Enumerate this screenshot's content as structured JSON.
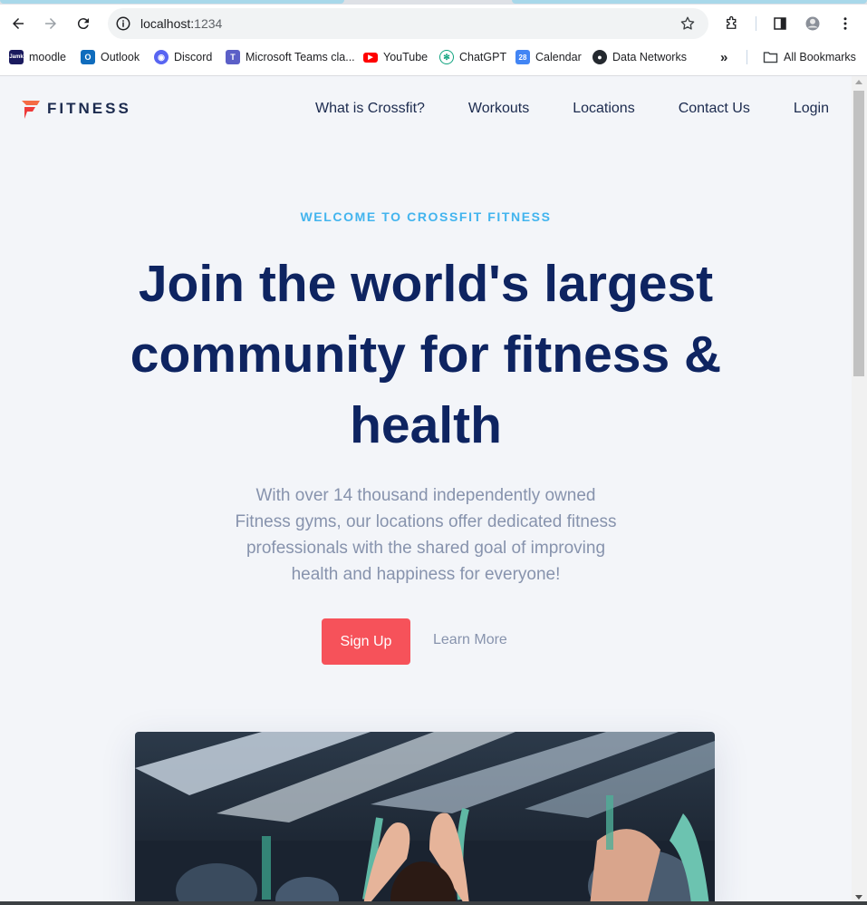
{
  "browser": {
    "url_host": "localhost:",
    "url_port": "1234",
    "bookmarks": [
      {
        "label": "moodle",
        "icon": "jamk-icon",
        "color": "#1a1a5e"
      },
      {
        "label": "Outlook",
        "icon": "outlook-icon",
        "color": "#0f6cbd"
      },
      {
        "label": "Discord",
        "icon": "discord-icon",
        "color": "#5865f2"
      },
      {
        "label": "Microsoft Teams cla...",
        "icon": "teams-icon",
        "color": "#5b5fc7"
      },
      {
        "label": "YouTube",
        "icon": "youtube-icon",
        "color": "#ff0000"
      },
      {
        "label": "ChatGPT",
        "icon": "chatgpt-icon",
        "color": "#10a37f"
      },
      {
        "label": "Calendar",
        "icon": "calendar-icon",
        "color": "#4285f4"
      },
      {
        "label": "Data Networks",
        "icon": "github-icon",
        "color": "#24292f"
      }
    ],
    "all_bookmarks_label": "All Bookmarks",
    "jamk_text": "Jamk",
    "calendar_day": "28"
  },
  "site": {
    "logo_text": "FITNESS",
    "nav": [
      "What is Crossfit?",
      "Workouts",
      "Locations",
      "Contact Us",
      "Login"
    ],
    "eyebrow": "WELCOME TO CROSSFIT FITNESS",
    "headline": "Join the world's largest community for fitness & health",
    "lede": "With over 14 thousand independently owned Fitness gyms, our locations offer dedicated fitness professionals with the shared goal of improving health and happiness for everyone!",
    "cta_primary": "Sign Up",
    "cta_secondary": "Learn More"
  },
  "colors": {
    "accent": "#f6525a",
    "eyebrow": "#42b4ee",
    "heading": "#0e2461",
    "body_text": "#8793ad",
    "page_bg": "#f3f5f9"
  }
}
